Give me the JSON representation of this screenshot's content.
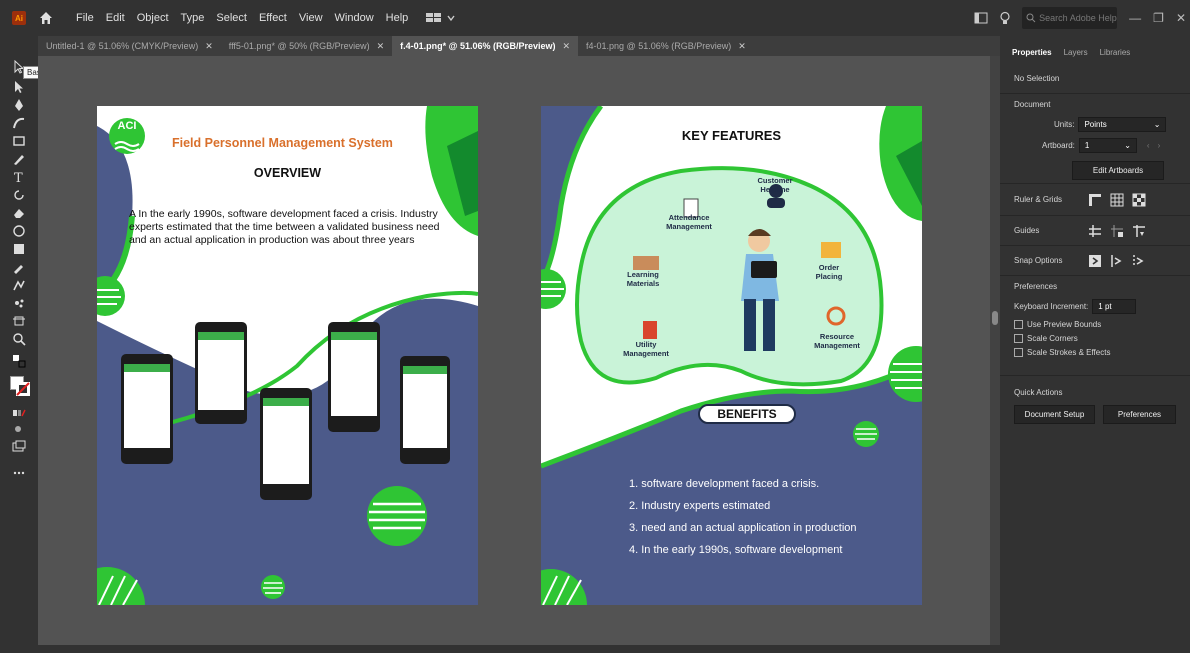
{
  "menubar": {
    "app_icon": "Ai",
    "items": [
      "File",
      "Edit",
      "Object",
      "Type",
      "Select",
      "Effect",
      "View",
      "Window",
      "Help"
    ],
    "search_placeholder": "Search Adobe Help"
  },
  "tabs": [
    {
      "label": "Untitled-1 @ 51.06% (CMYK/Preview)",
      "active": false
    },
    {
      "label": "fff5-01.png* @ 50% (RGB/Preview)",
      "active": false
    },
    {
      "label": "f.4-01.png* @ 51.06% (RGB/Preview)",
      "active": true
    },
    {
      "label": "f4-01.png @ 51.06% (RGB/Preview)",
      "active": false
    }
  ],
  "toolbar": {
    "tooltip": "Basic"
  },
  "left_artboard": {
    "logo": "ACI",
    "title": "Field Personnel Management System",
    "heading": "OVERVIEW",
    "body": "A In the early 1990s, software development faced a crisis. Industry experts estimated that the time between a validated business need and an actual application in production was about three years"
  },
  "right_artboard": {
    "heading": "KEY FEATURES",
    "features": [
      "Attendance Management",
      "Customer Helpline",
      "Learning Materials",
      "Order Placing",
      "Utility Management",
      "Resource Management"
    ],
    "benefits_heading": "BENEFITS",
    "benefits": [
      "1.  software development faced a crisis.",
      "2.  Industry experts estimated",
      "3.  need and an actual application in production",
      "4.  In the early 1990s, software development"
    ]
  },
  "properties_panel": {
    "tabs": [
      "Properties",
      "Layers",
      "Libraries"
    ],
    "selection": "No Selection",
    "document_label": "Document",
    "units_label": "Units:",
    "units_value": "Points",
    "artboard_label": "Artboard:",
    "artboard_value": "1",
    "edit_artboards": "Edit Artboards",
    "ruler_grids": "Ruler & Grids",
    "guides": "Guides",
    "snap_options": "Snap Options",
    "preferences_label": "Preferences",
    "keyboard_increment_label": "Keyboard Increment:",
    "keyboard_increment_value": "1 pt",
    "checkboxes": [
      "Use Preview Bounds",
      "Scale Corners",
      "Scale Strokes & Effects"
    ],
    "quick_actions": "Quick Actions",
    "document_setup": "Document Setup",
    "preferences_button": "Preferences"
  },
  "colors": {
    "accent_green": "#2fc534",
    "navy": "#4c5a8a",
    "mint": "#c9f3d8",
    "title_orange": "#d9702c"
  }
}
